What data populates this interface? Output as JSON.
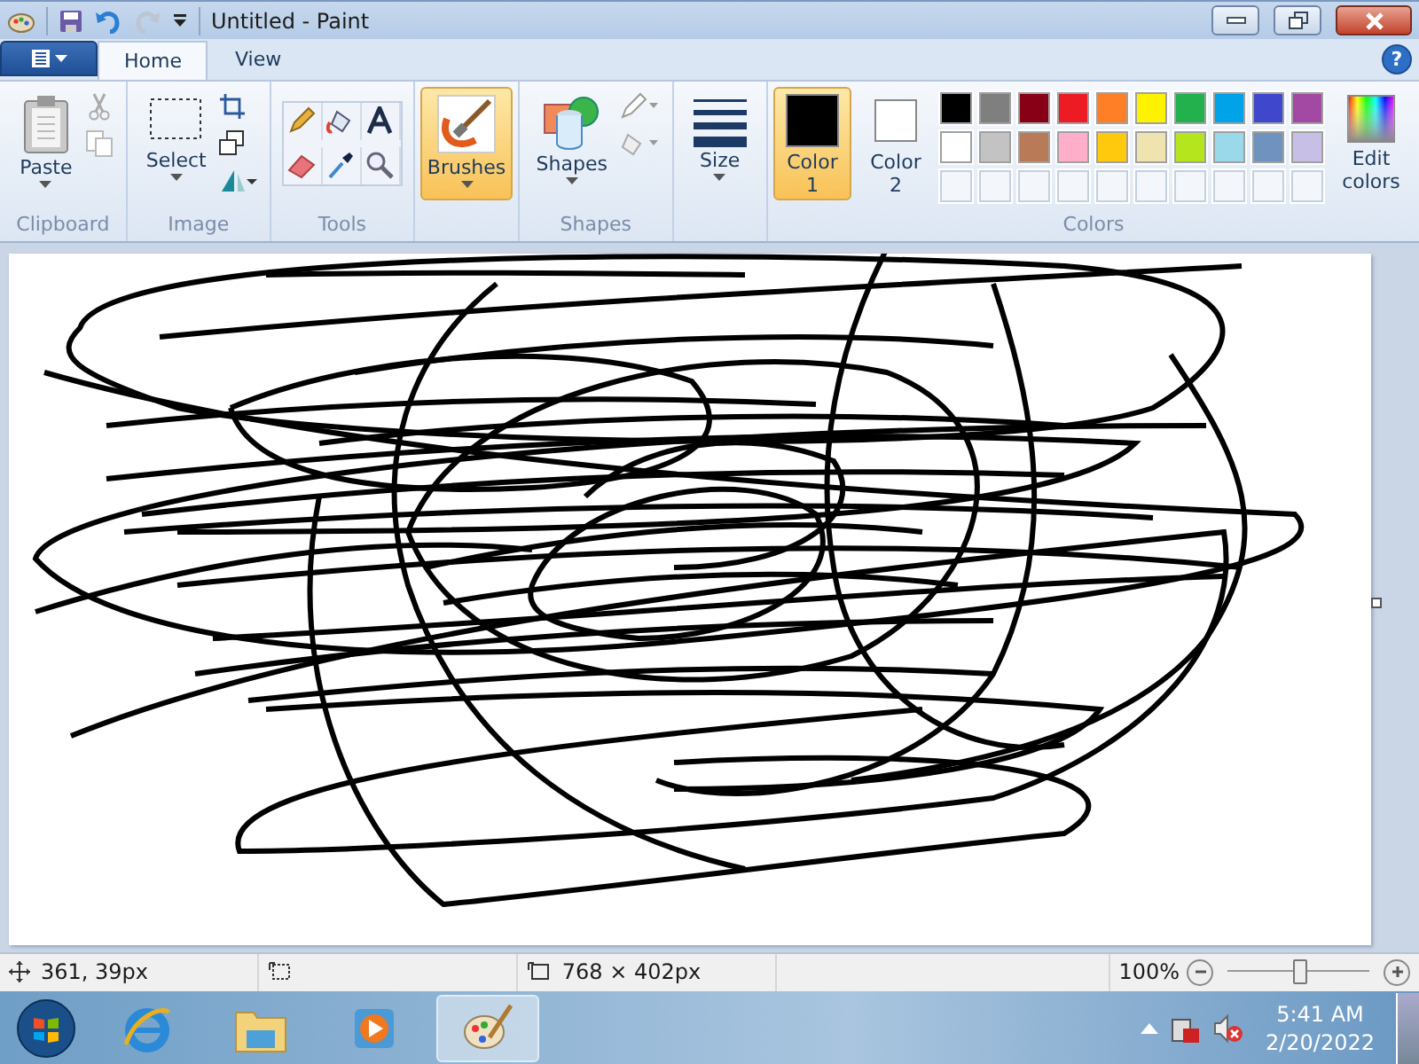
{
  "window": {
    "title": "Untitled - Paint"
  },
  "help": "?",
  "tabs": [
    {
      "label": "Home",
      "selected": true
    },
    {
      "label": "View",
      "selected": false
    }
  ],
  "ribbon": {
    "clipboard": {
      "label": "Clipboard",
      "paste": "Paste"
    },
    "image": {
      "label": "Image",
      "select": "Select"
    },
    "tools": {
      "label": "Tools"
    },
    "brushes": {
      "label": "Brushes",
      "selected": true
    },
    "shapes": {
      "label": "Shapes",
      "group_label": "Shapes"
    },
    "size": {
      "label": "Size"
    },
    "colors": {
      "label": "Colors",
      "color1": {
        "label": "Color 1",
        "color": "#000000",
        "selected": true
      },
      "color2": {
        "label": "Color 2",
        "color": "#ffffff",
        "selected": false
      },
      "edit": "Edit colors",
      "palette": [
        {
          "color": "#000000"
        },
        {
          "color": "#7f7f7f"
        },
        {
          "color": "#880015"
        },
        {
          "color": "#ed1c24"
        },
        {
          "color": "#ff7f27"
        },
        {
          "color": "#fff200"
        },
        {
          "color": "#22b14c"
        },
        {
          "color": "#00a2e8"
        },
        {
          "color": "#3f48cc"
        },
        {
          "color": "#a349a4"
        },
        {
          "color": "#ffffff"
        },
        {
          "color": "#c3c3c3"
        },
        {
          "color": "#b97a57"
        },
        {
          "color": "#ffaec9"
        },
        {
          "color": "#ffc90e"
        },
        {
          "color": "#efe4b0"
        },
        {
          "color": "#b5e61d"
        },
        {
          "color": "#99d9ea"
        },
        {
          "color": "#7092be"
        },
        {
          "color": "#c8bfe7"
        }
      ]
    }
  },
  "status_bar": {
    "position": "361, 39px",
    "canvas_size": "768 × 402px",
    "zoom": "100%",
    "zoom_slider": {
      "level": 0.5
    }
  },
  "taskbar": {
    "apps": [
      {
        "kind": "browser",
        "selected": false
      },
      {
        "kind": "folder",
        "selected": false
      },
      {
        "kind": "media",
        "selected": false
      },
      {
        "kind": "paint",
        "selected": true
      }
    ],
    "time": "5:41 AM",
    "date": "2/20/2022"
  }
}
